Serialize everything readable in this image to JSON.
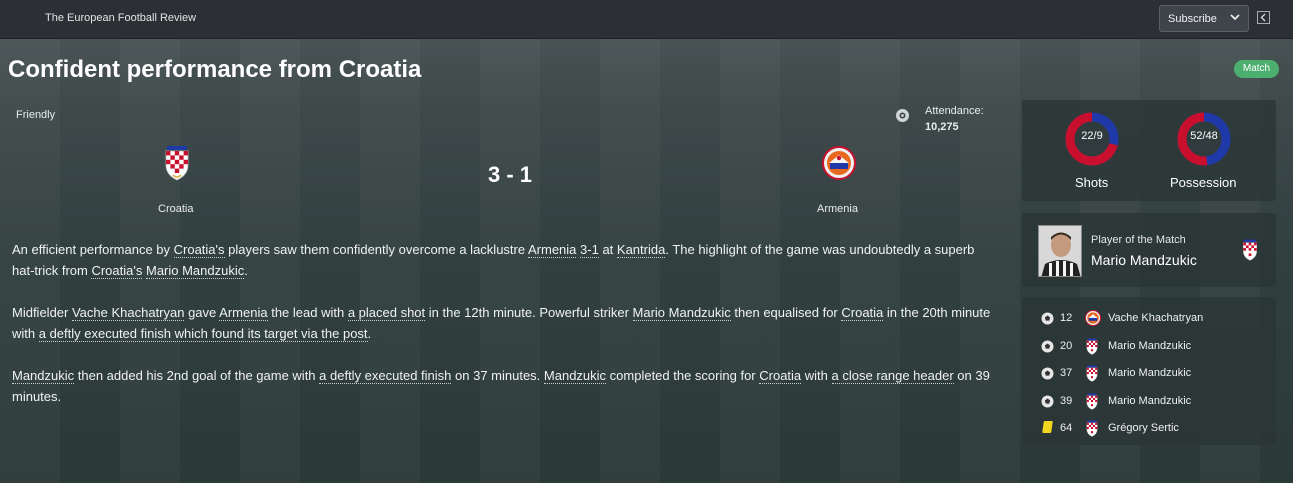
{
  "header": {
    "publication": "The European Football Review",
    "subscribe_label": "Subscribe",
    "collapse_icon": "collapse-panel-icon"
  },
  "article": {
    "headline": "Confident performance from Croatia",
    "badge": "Match"
  },
  "match": {
    "competition": "Friendly",
    "attendance_label": "Attendance:",
    "attendance_value": "10,275",
    "home_team": "Croatia",
    "away_team": "Armenia",
    "score": "3 - 1",
    "colors": {
      "croatia": "#c8102e",
      "armenia": "#1f3aa8",
      "accent_green": "#4caf70",
      "yellow_card": "#f2d622"
    }
  },
  "report": {
    "paragraphs": [
      [
        {
          "t": "An efficient performance by "
        },
        {
          "t": "Croatia's",
          "link": true
        },
        {
          "t": " players saw them confidently overcome a lacklustre "
        },
        {
          "t": "Armenia",
          "link": true
        },
        {
          "t": " "
        },
        {
          "t": "3-1",
          "link": true
        },
        {
          "t": " at "
        },
        {
          "t": "Kantrida",
          "link": true
        },
        {
          "t": ". The highlight of the game was undoubtedly a superb hat-trick from "
        },
        {
          "t": "Croatia's",
          "link": true
        },
        {
          "t": " "
        },
        {
          "t": "Mario Mandzukic",
          "link": true
        },
        {
          "t": "."
        }
      ],
      [
        {
          "t": "Midfielder "
        },
        {
          "t": "Vache Khachatryan",
          "link": true
        },
        {
          "t": " gave "
        },
        {
          "t": "Armenia",
          "link": true
        },
        {
          "t": " the lead with "
        },
        {
          "t": "a placed shot",
          "link": true
        },
        {
          "t": " in the 12th minute. Powerful striker "
        },
        {
          "t": "Mario Mandzukic",
          "link": true
        },
        {
          "t": " then equalised for "
        },
        {
          "t": "Croatia",
          "link": true
        },
        {
          "t": " in the 20th minute with "
        },
        {
          "t": "a deftly executed finish which found its target via the post",
          "link": true
        },
        {
          "t": "."
        }
      ],
      [
        {
          "t": "Mandzukic",
          "link": true
        },
        {
          "t": " then added his 2nd goal of the game with "
        },
        {
          "t": "a deftly executed finish",
          "link": true
        },
        {
          "t": " on 37 minutes. "
        },
        {
          "t": "Mandzukic",
          "link": true
        },
        {
          "t": " completed the scoring for "
        },
        {
          "t": "Croatia",
          "link": true
        },
        {
          "t": " with "
        },
        {
          "t": "a close range header",
          "link": true
        },
        {
          "t": " on 39 minutes."
        }
      ]
    ]
  },
  "stats": {
    "shots": {
      "label": "Shots",
      "display": "22/9",
      "home": 22,
      "away": 9
    },
    "possession": {
      "label": "Possession",
      "display": "52/48",
      "home": 52,
      "away": 48
    }
  },
  "potm": {
    "title": "Player of the Match",
    "name": "Mario Mandzukic"
  },
  "events": [
    {
      "type": "goal-icon",
      "minute": "12",
      "team": "armenia",
      "player": "Vache Khachatryan"
    },
    {
      "type": "goal-icon",
      "minute": "20",
      "team": "croatia",
      "player": "Mario Mandzukic"
    },
    {
      "type": "goal-icon",
      "minute": "37",
      "team": "croatia",
      "player": "Mario Mandzukic"
    },
    {
      "type": "goal-icon",
      "minute": "39",
      "team": "croatia",
      "player": "Mario Mandzukic"
    },
    {
      "type": "yellow-card-icon",
      "minute": "64",
      "team": "croatia",
      "player": "Grégory Sertic"
    }
  ]
}
